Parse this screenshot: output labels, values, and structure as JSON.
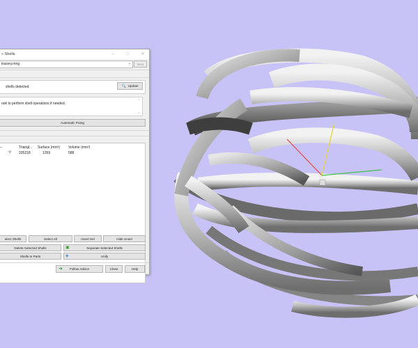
{
  "dialog": {
    "title": "» Shells",
    "window_buttons": {
      "minimize": "–",
      "maximize": "□",
      "close": "✕"
    },
    "object_combo": {
      "value": "tracery.mng"
    },
    "next_button": "Next",
    "detect_text": "shells detected",
    "update_button": "Update",
    "advice_text": "ook to perform shell operations if needed.",
    "automatic_fixing_button": "Automatic Fixing",
    "table": {
      "columns": [
        "Triangl...",
        "Surface (mm²)",
        "Volume (mm³)"
      ],
      "rows": [
        {
          "triangles": "335218",
          "surface": "1269",
          "volume": "588"
        }
      ]
    },
    "row1_buttons": [
      "elect Shells",
      "Select All",
      "Invert Sel",
      "Hide Unsel"
    ],
    "delete_button": "Delete Selected Shells",
    "separate_button": "Separate Selected Shells",
    "shells_to_parts_button": "Shells to Parts",
    "unify_button": "Unify",
    "follow_advice_button": "Follow Advice",
    "close_button": "Close",
    "help_button": "Help"
  },
  "viewport": {
    "background": "#c7c3f6",
    "axis_colors": {
      "x": "#e8443a",
      "y": "#e6d23a",
      "z": "#3ec24a"
    }
  }
}
